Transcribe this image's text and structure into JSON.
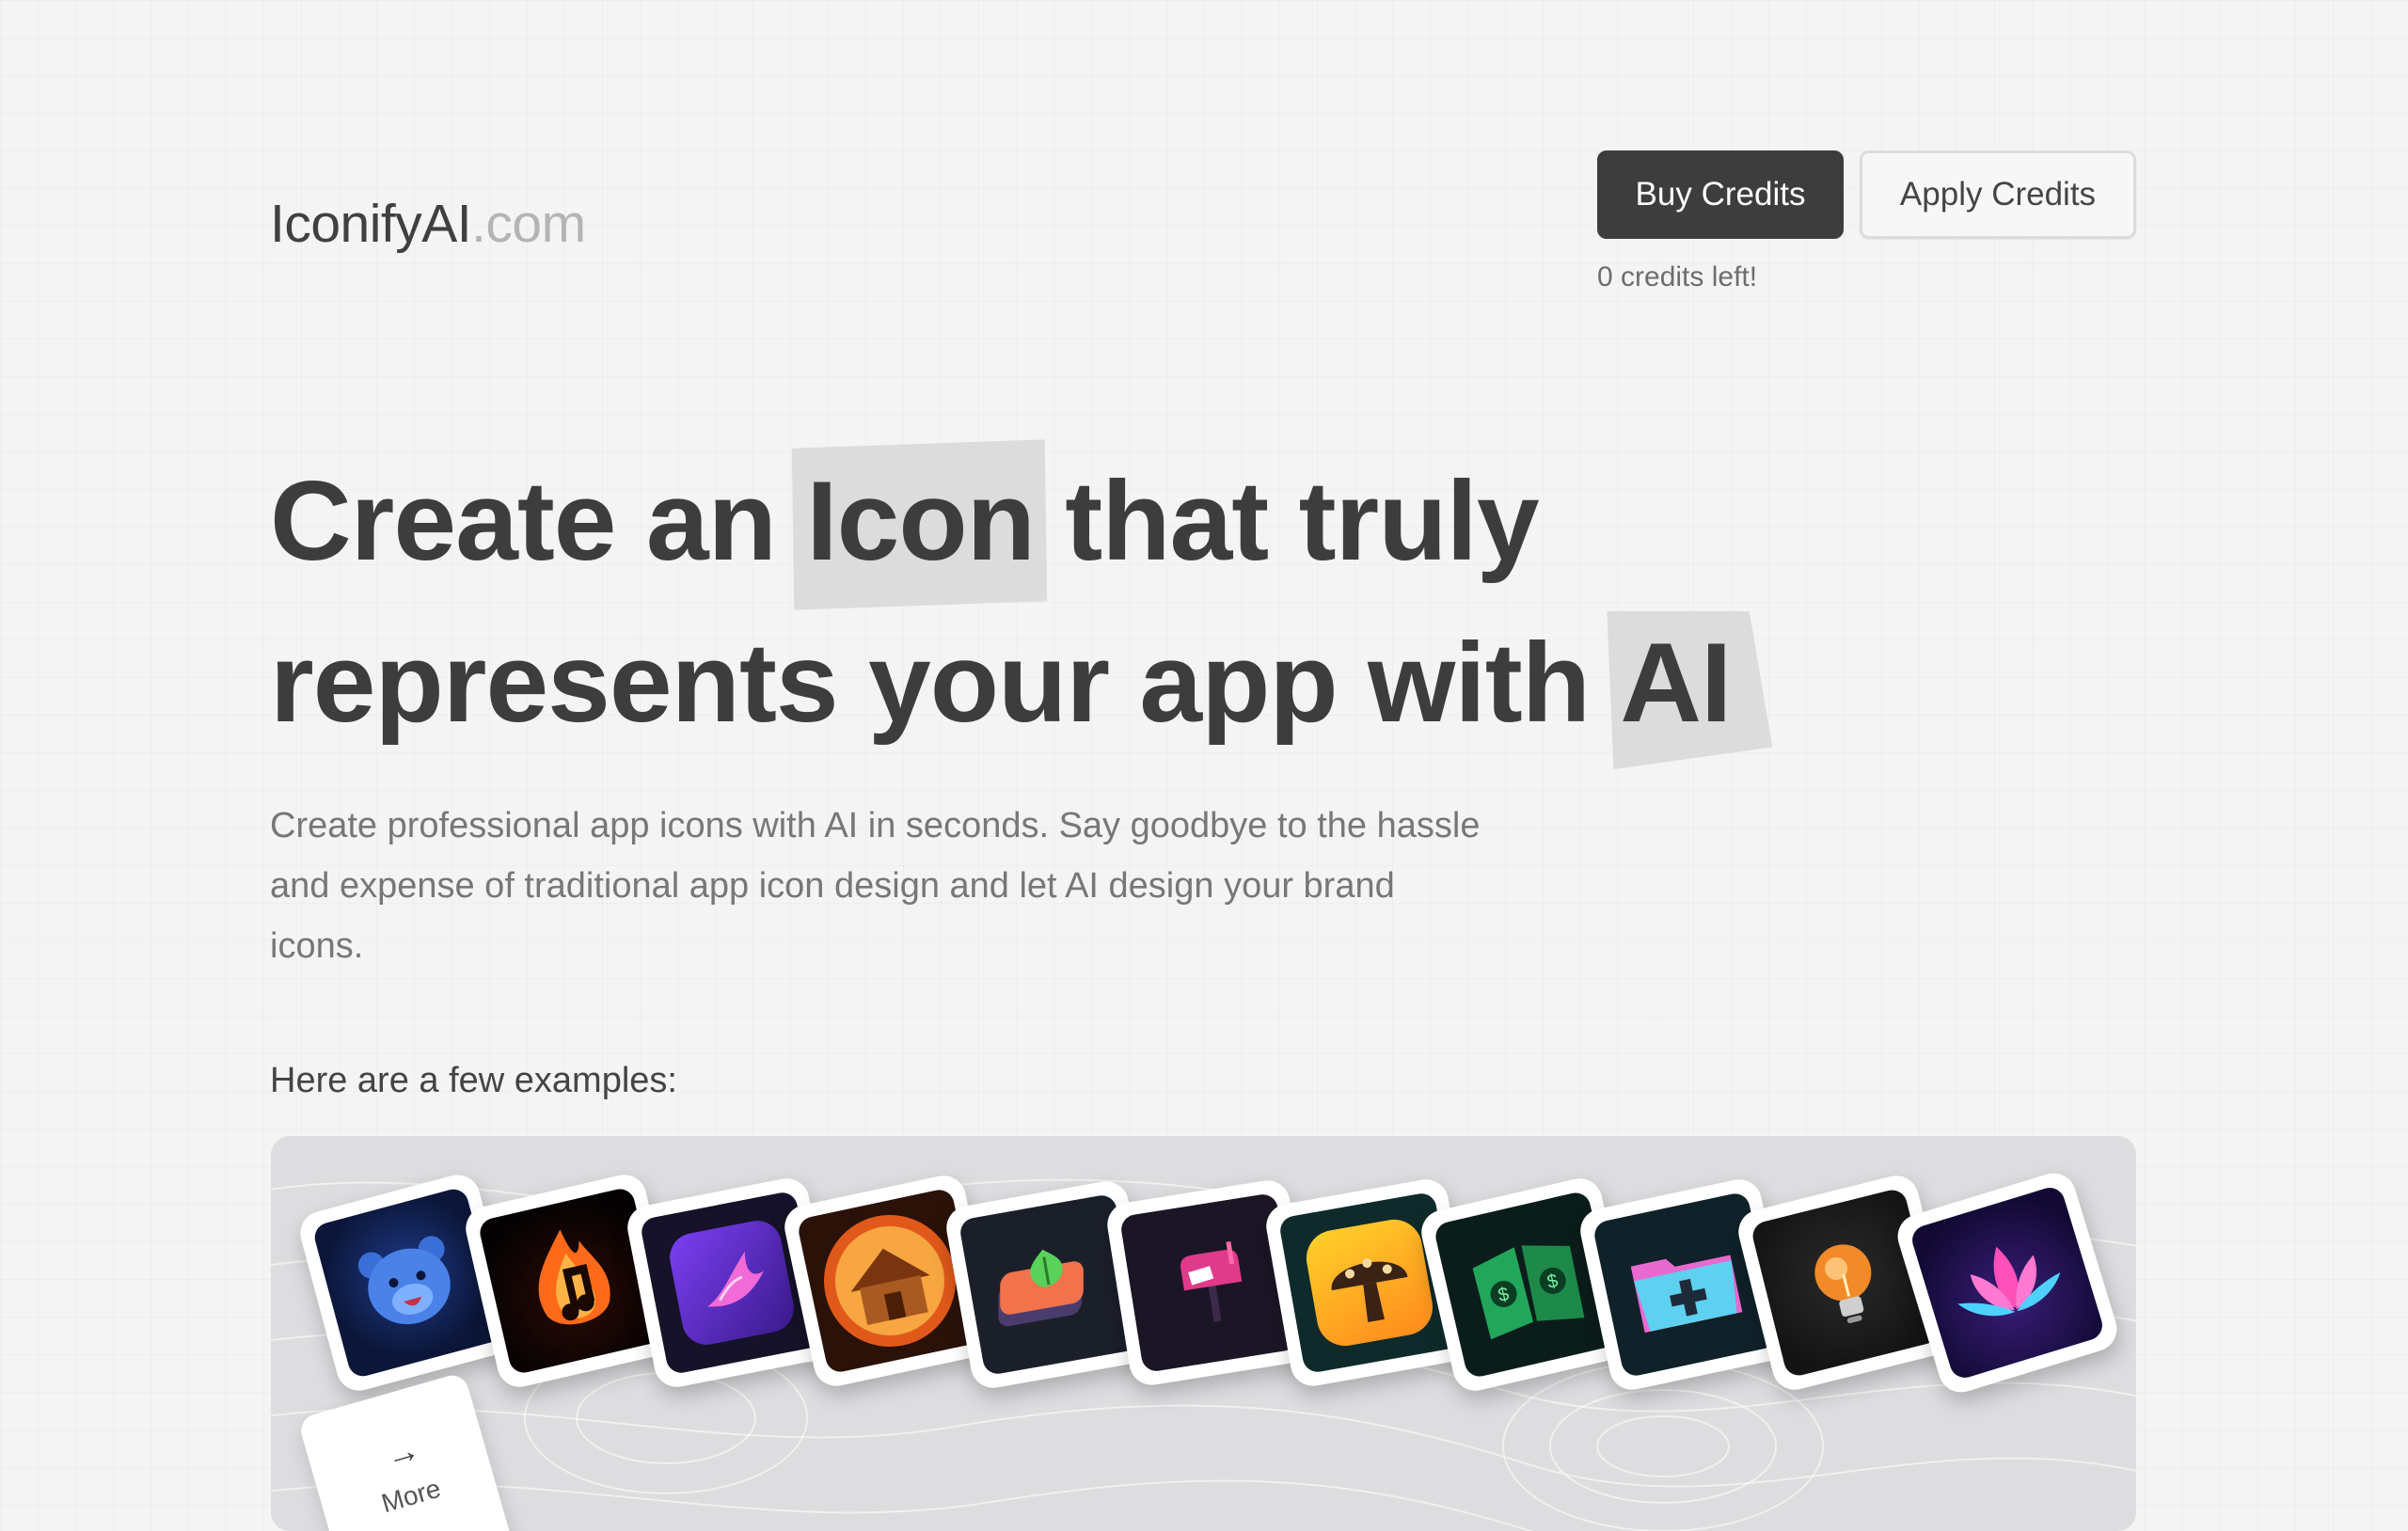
{
  "brand": {
    "name": "IconifyAI",
    "domain": ".com"
  },
  "header": {
    "buy_label": "Buy Credits",
    "apply_label": "Apply Credits",
    "credits_text": "0 credits left!"
  },
  "hero": {
    "line1_before": "Create an ",
    "line1_highlight": "Icon",
    "line1_after": " that truly",
    "line2_before": "represents your app with ",
    "line2_highlight": "AI",
    "subtitle": "Create professional app icons with AI in seconds. Say goodbye to the hassle and expense of traditional app icon design and let AI design your brand icons."
  },
  "examples": {
    "label": "Here are a few examples:",
    "more_label": "More",
    "icons": [
      "bear-app-icon",
      "fire-music-app-icon",
      "purple-bird-app-icon",
      "wooden-house-app-icon",
      "layered-leaf-app-icon",
      "mailbox-app-icon",
      "mushroom-app-icon",
      "money-book-app-icon",
      "folder-plus-app-icon",
      "lightbulb-app-icon",
      "lotus-app-icon"
    ]
  },
  "colors": {
    "primary_button": "#3d3d3d",
    "background": "#f4f4f4",
    "highlight": "#dcdcdc",
    "showcase_panel": "#dddde0"
  }
}
